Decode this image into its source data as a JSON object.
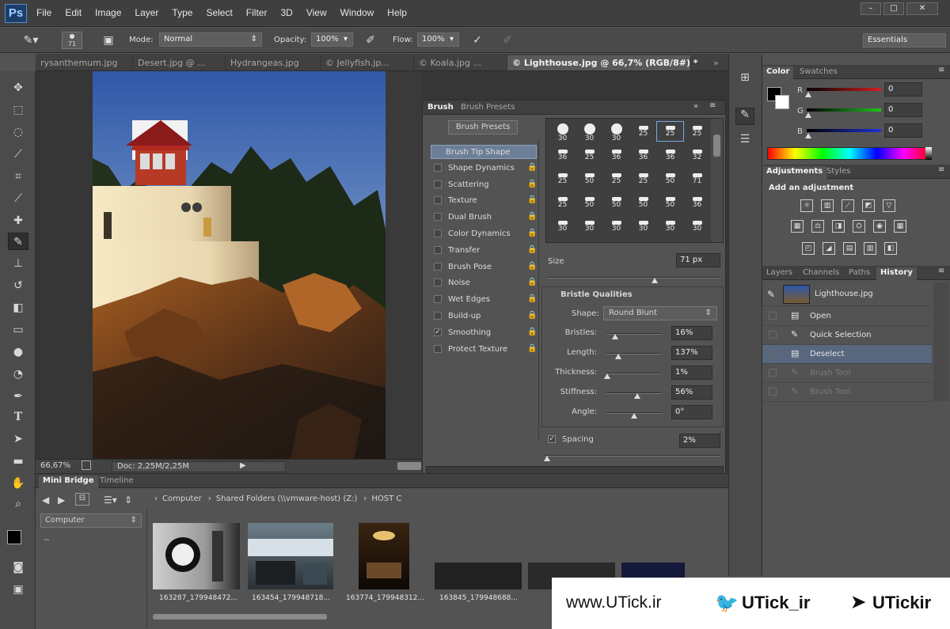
{
  "app": {
    "logo": "Ps"
  },
  "menu": [
    "File",
    "Edit",
    "Image",
    "Layer",
    "Type",
    "Select",
    "Filter",
    "3D",
    "View",
    "Window",
    "Help"
  ],
  "window_controls": [
    "–",
    "□",
    "✕"
  ],
  "options_bar": {
    "brush_size": "71",
    "mode_label": "Mode:",
    "mode_value": "Normal",
    "opacity_label": "Opacity:",
    "opacity_value": "100%",
    "flow_label": "Flow:",
    "flow_value": "100%",
    "workspace": "Essentials"
  },
  "doc_tabs": [
    "rysanthemum.jpg",
    "Desert.jpg @ ...",
    "Hydrangeas.jpg",
    "© Jellyfish.jp...",
    "© Koala.jpg ...",
    "© Lighthouse.jpg @ 66,7% (RGB/8#) *"
  ],
  "tabs_overflow": "»",
  "status": {
    "zoom": "66,67%",
    "doc": "Doc: 2,25M/2,25M"
  },
  "brush_panel": {
    "tabs": [
      "Brush",
      "Brush Presets"
    ],
    "presets_button": "Brush Presets",
    "options": [
      {
        "label": "Brush Tip Shape",
        "checked": false,
        "active": true,
        "lock": false
      },
      {
        "label": "Shape Dynamics",
        "checked": false,
        "lock": true
      },
      {
        "label": "Scattering",
        "checked": false,
        "lock": true
      },
      {
        "label": "Texture",
        "checked": false,
        "lock": true
      },
      {
        "label": "Dual Brush",
        "checked": false,
        "lock": true
      },
      {
        "label": "Color Dynamics",
        "checked": false,
        "lock": true
      },
      {
        "label": "Transfer",
        "checked": false,
        "lock": true
      },
      {
        "label": "Brush Pose",
        "checked": false,
        "lock": true
      },
      {
        "label": "Noise",
        "checked": false,
        "lock": true
      },
      {
        "label": "Wet Edges",
        "checked": false,
        "lock": true
      },
      {
        "label": "Build-up",
        "checked": false,
        "lock": true
      },
      {
        "label": "Smoothing",
        "checked": true,
        "lock": true
      },
      {
        "label": "Protect Texture",
        "checked": false,
        "lock": true
      }
    ],
    "grid_sizes": [
      [
        "30",
        "30",
        "30",
        "25",
        "25",
        "25"
      ],
      [
        "36",
        "25",
        "36",
        "36",
        "36",
        "32"
      ],
      [
        "25",
        "50",
        "25",
        "25",
        "50",
        "71"
      ],
      [
        "25",
        "50",
        "50",
        "50",
        "50",
        "36"
      ],
      [
        "30",
        "30",
        "30",
        "30",
        "30",
        "30"
      ]
    ],
    "size_label": "Size",
    "size_value": "71 px",
    "size_fraction": 0.62,
    "bristle_title": "Bristle Qualities",
    "shape_label": "Shape:",
    "shape_value": "Round Blunt",
    "sliders": [
      {
        "label": "Bristles:",
        "value": "16%",
        "fraction": 0.16
      },
      {
        "label": "Length:",
        "value": "137%",
        "fraction": 0.22
      },
      {
        "label": "Thickness:",
        "value": "1%",
        "fraction": 0.01
      },
      {
        "label": "Stiffness:",
        "value": "56%",
        "fraction": 0.56
      },
      {
        "label": "Angle:",
        "value": "0°",
        "fraction": 0.5
      }
    ],
    "spacing_label": "Spacing",
    "spacing_value": "2%",
    "spacing_checked": true
  },
  "color_panel": {
    "tabs": [
      "Color",
      "Swatches"
    ],
    "channels": [
      {
        "label": "R",
        "value": "0",
        "color": "#d41e1e"
      },
      {
        "label": "G",
        "value": "0",
        "color": "#1ec41e"
      },
      {
        "label": "B",
        "value": "0",
        "color": "#2030d8"
      }
    ]
  },
  "adjustments_panel": {
    "tabs": [
      "Adjustments",
      "Styles"
    ],
    "title": "Add an adjustment",
    "icons": [
      "brightness-icon",
      "levels-icon",
      "curves-icon",
      "exposure-icon",
      "vibrance-icon",
      "hue-saturation-icon",
      "color-balance-icon",
      "black-white-icon",
      "photo-filter-icon",
      "channel-mixer-icon",
      "color-lookup-icon",
      "invert-icon",
      "posterize-icon",
      "threshold-icon",
      "gradient-map-icon",
      "selective-color-icon"
    ]
  },
  "history_panel": {
    "tabs": [
      "Layers",
      "Channels",
      "Paths",
      "History"
    ],
    "snapshot": "Lighthouse.jpg",
    "items": [
      {
        "label": "Open",
        "state": "normal"
      },
      {
        "label": "Quick Selection",
        "state": "normal"
      },
      {
        "label": "Deselect",
        "state": "selected"
      },
      {
        "label": "Brush Tool",
        "state": "dim"
      },
      {
        "label": "Brush Tool",
        "state": "dim"
      }
    ]
  },
  "mini_bridge": {
    "tabs": [
      "Mini Bridge",
      "Timeline"
    ],
    "breadcrumb": [
      "Computer",
      "Shared Folders (\\\\vmware-host) (Z:)",
      "HOST C"
    ],
    "location": "Computer",
    "tree_item": "--",
    "thumbs": [
      "163287_179948472...",
      "163454_179948718...",
      "163774_179948312...",
      "163845_179948688..."
    ]
  },
  "watermark": {
    "site": "www.UTick.ir",
    "twitter": "UTick_ir",
    "telegram": "UTickir"
  }
}
